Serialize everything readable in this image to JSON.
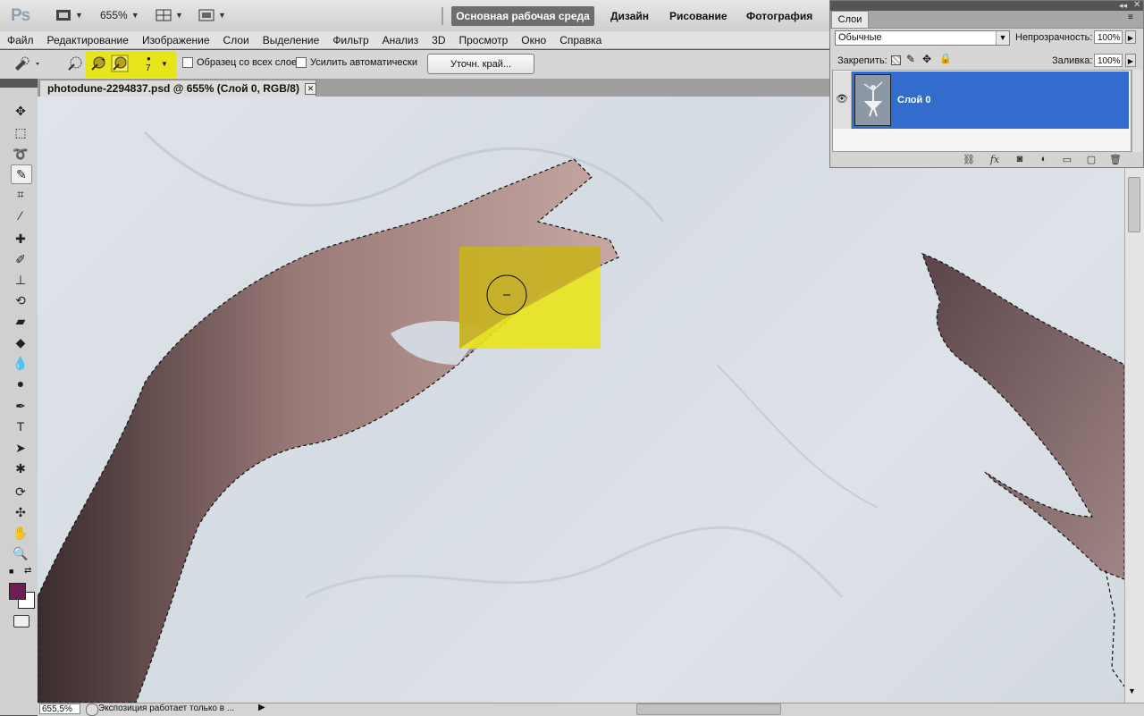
{
  "appbar": {
    "logo": "Ps",
    "zoom": "655%",
    "workspace_active": "Основная рабочая среда",
    "workspaces": [
      "Дизайн",
      "Рисование",
      "Фотография"
    ]
  },
  "menu": [
    "Файл",
    "Редактирование",
    "Изображение",
    "Слои",
    "Выделение",
    "Фильтр",
    "Анализ",
    "3D",
    "Просмотр",
    "Окно",
    "Справка"
  ],
  "options": {
    "brush_size": "7",
    "sample_all_layers": "Образец со всех слоев",
    "auto_enhance": "Усилить автоматически",
    "refine_edge": "Уточн. край..."
  },
  "document": {
    "tab_title": "photodune-2294837.psd @ 655% (Слой 0, RGB/8)"
  },
  "status": {
    "zoom": "655,5%",
    "message": "Экспозиция работает только в ..."
  },
  "colors": {
    "foreground": "#701d57",
    "background": "#ffffff",
    "highlight": "#e8e41a",
    "selected_layer": "#326ccc"
  },
  "layers_panel": {
    "tab": "Слои",
    "blend_mode": "Обычные",
    "opacity_label": "Непрозрачность:",
    "opacity": "100%",
    "lock_label": "Закрепить:",
    "fill_label": "Заливка:",
    "fill": "100%",
    "layers": [
      {
        "name": "Слой 0",
        "visible": true,
        "selected": true
      }
    ]
  }
}
